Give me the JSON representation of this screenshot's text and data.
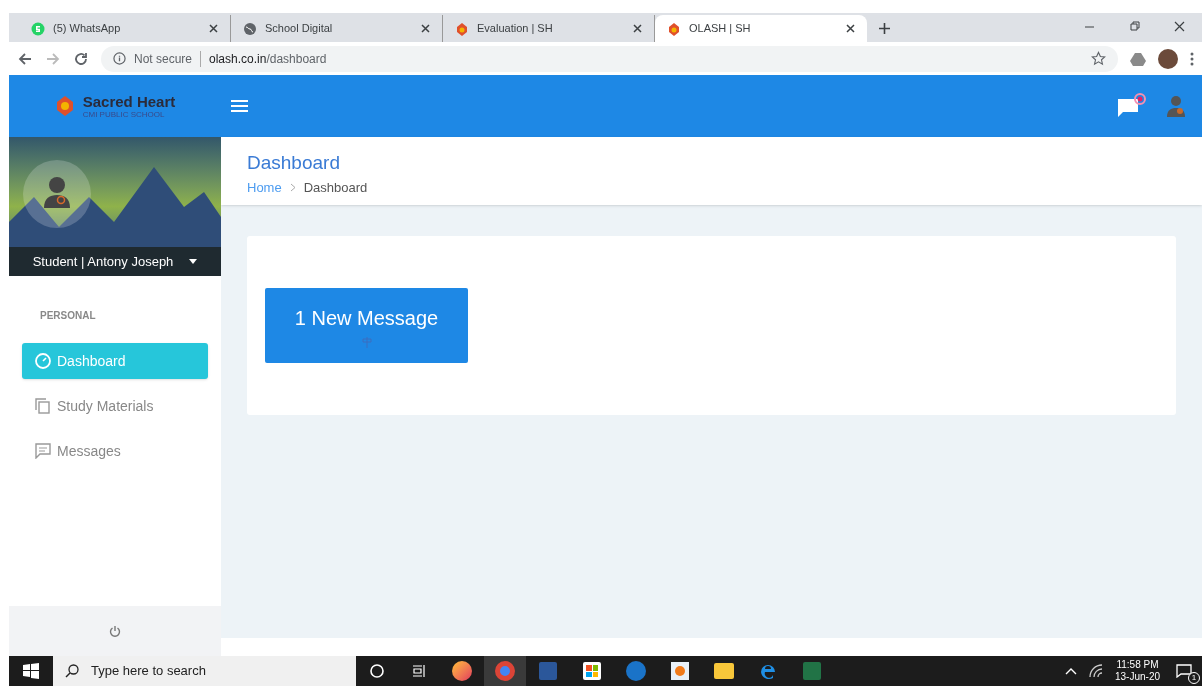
{
  "browser": {
    "tabs": [
      {
        "label": "(5) WhatsApp",
        "kind": "whatsapp",
        "selected": false
      },
      {
        "label": "School Digital",
        "kind": "globe",
        "selected": false
      },
      {
        "label": "Evaluation | SH",
        "kind": "school",
        "selected": false
      },
      {
        "label": "OLASH | SH",
        "kind": "school",
        "selected": true
      }
    ],
    "security": "Not secure",
    "url_host": "olash.co.in",
    "url_path": "/dashboard"
  },
  "header": {
    "school_name": "Sacred Heart",
    "school_subtitle": "CMI PUBLIC SCHOOL",
    "has_unread_messages": true
  },
  "sidebar": {
    "profile": "Student | Antony Joseph",
    "section": "PERSONAL",
    "items": [
      {
        "label": "Dashboard",
        "kind": "dashboard",
        "selected": true
      },
      {
        "label": "Study Materials",
        "kind": "materials",
        "selected": false
      },
      {
        "label": "Messages",
        "kind": "messages",
        "selected": false
      }
    ]
  },
  "page": {
    "title": "Dashboard",
    "breadcrumb": [
      "Home",
      "Dashboard"
    ],
    "message_button": "1 New Message"
  },
  "taskbar": {
    "search_placeholder": "Type here to search",
    "time": "11:58 PM",
    "date": "13-Jun-20",
    "notifications": "1"
  }
}
